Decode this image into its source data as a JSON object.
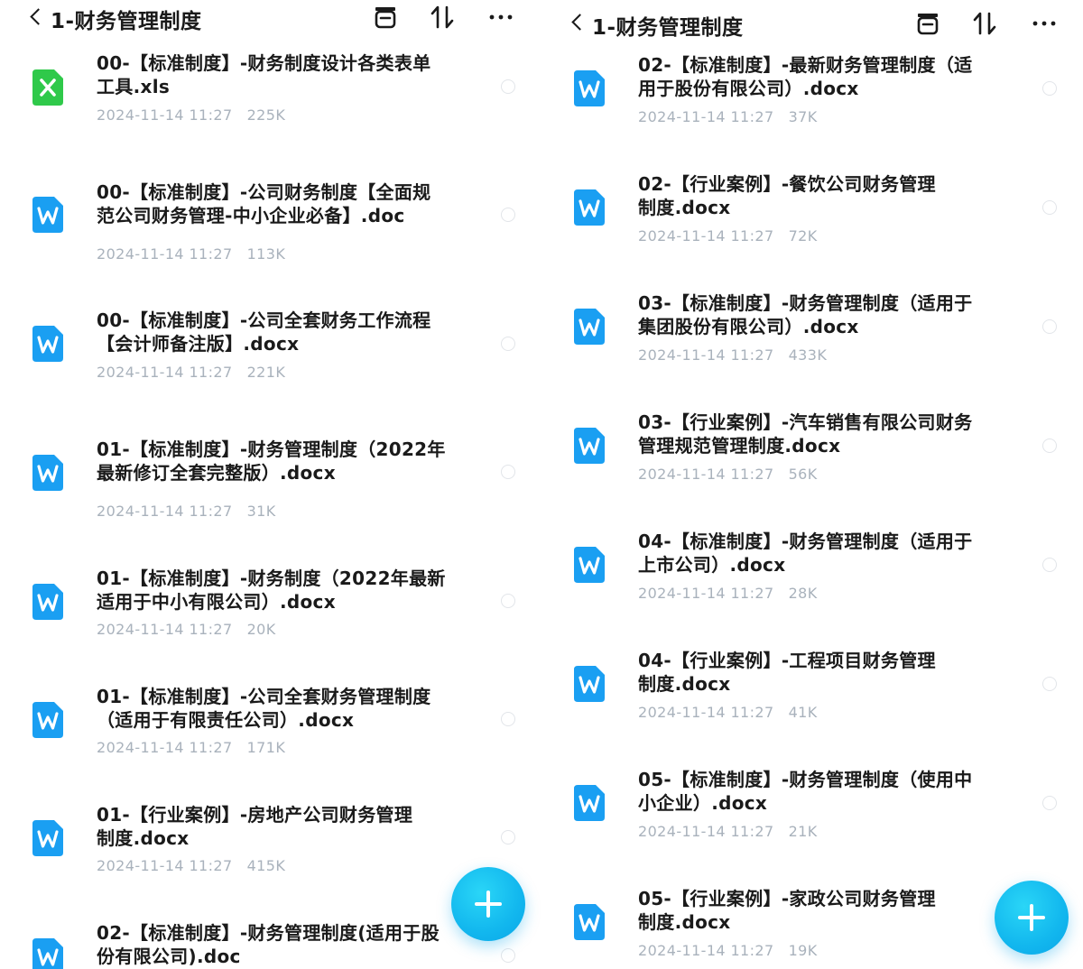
{
  "panels": [
    {
      "header": {
        "title": "1-财务管理制度"
      },
      "fab": {
        "label": "+"
      },
      "files": [
        {
          "name": "00-【标准制度】-财务制度设计各类表单\n工具.xls",
          "date": "2024-11-14 11:27",
          "size": "225K",
          "type": "xls",
          "icon": "excel-icon"
        },
        {
          "name": "00-【标准制度】-公司财务制度【全面规\n范公司财务管理-中小企业必备】.doc",
          "date": "2024-11-14 11:27",
          "size": "113K",
          "type": "doc",
          "icon": "word-icon"
        },
        {
          "name": "00-【标准制度】-公司全套财务工作流程\n【会计师备注版】.docx",
          "date": "2024-11-14 11:27",
          "size": "221K",
          "type": "doc",
          "icon": "word-icon"
        },
        {
          "name": "01-【标准制度】-财务管理制度（2022年\n最新修订全套完整版）.docx",
          "date": "2024-11-14 11:27",
          "size": "31K",
          "type": "doc",
          "icon": "word-icon"
        },
        {
          "name": "01-【标准制度】-财务制度（2022年最新\n适用于中小有限公司）.docx",
          "date": "2024-11-14 11:27",
          "size": "20K",
          "type": "doc",
          "icon": "word-icon"
        },
        {
          "name": "01-【标准制度】-公司全套财务管理制度\n（适用于有限责任公司）.docx",
          "date": "2024-11-14 11:27",
          "size": "171K",
          "type": "doc",
          "icon": "word-icon"
        },
        {
          "name": "01-【行业案例】-房地产公司财务管理\n制度.docx",
          "date": "2024-11-14 11:27",
          "size": "415K",
          "type": "doc",
          "icon": "word-icon"
        },
        {
          "name": "02-【标准制度】-财务管理制度(适用于股\n份有限公司).doc",
          "date": "",
          "size": "",
          "type": "doc",
          "icon": "word-icon"
        }
      ]
    },
    {
      "header": {
        "title": "1-财务管理制度"
      },
      "fab": {
        "label": "+"
      },
      "files": [
        {
          "name": "02-【标准制度】-最新财务管理制度（适\n用于股份有限公司）.docx",
          "date": "2024-11-14 11:27",
          "size": "37K",
          "type": "doc",
          "icon": "word-icon"
        },
        {
          "name": "02-【行业案例】-餐饮公司财务管理\n制度.docx",
          "date": "2024-11-14 11:27",
          "size": "72K",
          "type": "doc",
          "icon": "word-icon"
        },
        {
          "name": "03-【标准制度】-财务管理制度（适用于\n集团股份有限公司）.docx",
          "date": "2024-11-14 11:27",
          "size": "433K",
          "type": "doc",
          "icon": "word-icon"
        },
        {
          "name": "03-【行业案例】-汽车销售有限公司财务\n管理规范管理制度.docx",
          "date": "2024-11-14 11:27",
          "size": "56K",
          "type": "doc",
          "icon": "word-icon"
        },
        {
          "name": "04-【标准制度】-财务管理制度（适用于\n上市公司）.docx",
          "date": "2024-11-14 11:27",
          "size": "28K",
          "type": "doc",
          "icon": "word-icon"
        },
        {
          "name": "04-【行业案例】-工程项目财务管理\n制度.docx",
          "date": "2024-11-14 11:27",
          "size": "41K",
          "type": "doc",
          "icon": "word-icon"
        },
        {
          "name": "05-【标准制度】-财务管理制度（使用中\n小企业）.docx",
          "date": "2024-11-14 11:27",
          "size": "21K",
          "type": "doc",
          "icon": "word-icon"
        },
        {
          "name": "05-【行业案例】-家政公司财务管理\n制度.docx",
          "date": "2024-11-14 11:27",
          "size": "19K",
          "type": "doc",
          "icon": "word-icon"
        }
      ]
    }
  ],
  "colors": {
    "accent": "#12b7ee",
    "word_icon": "#1a9ff2",
    "excel_icon": "#2fc94a",
    "meta_text": "#a9b2bc"
  }
}
